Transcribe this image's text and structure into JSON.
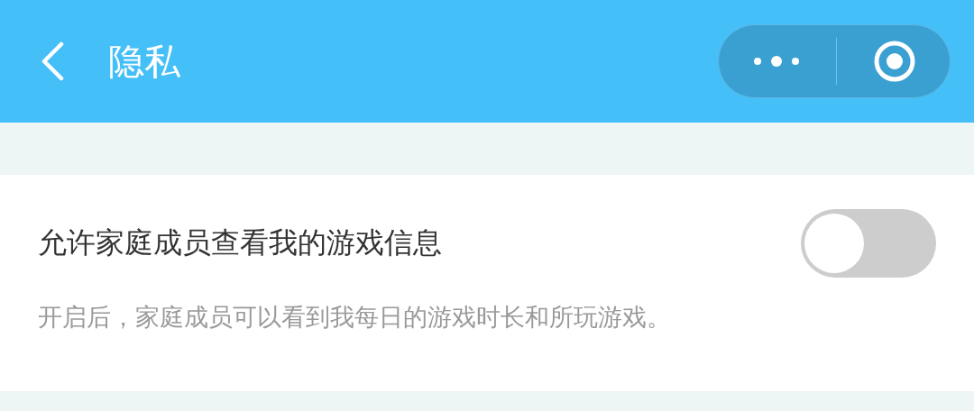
{
  "header": {
    "title": "隐私"
  },
  "setting": {
    "label": "允许家庭成员查看我的游戏信息",
    "on": false,
    "description": "开启后，家庭成员可以看到我每日的游戏时长和所玩游戏。"
  }
}
